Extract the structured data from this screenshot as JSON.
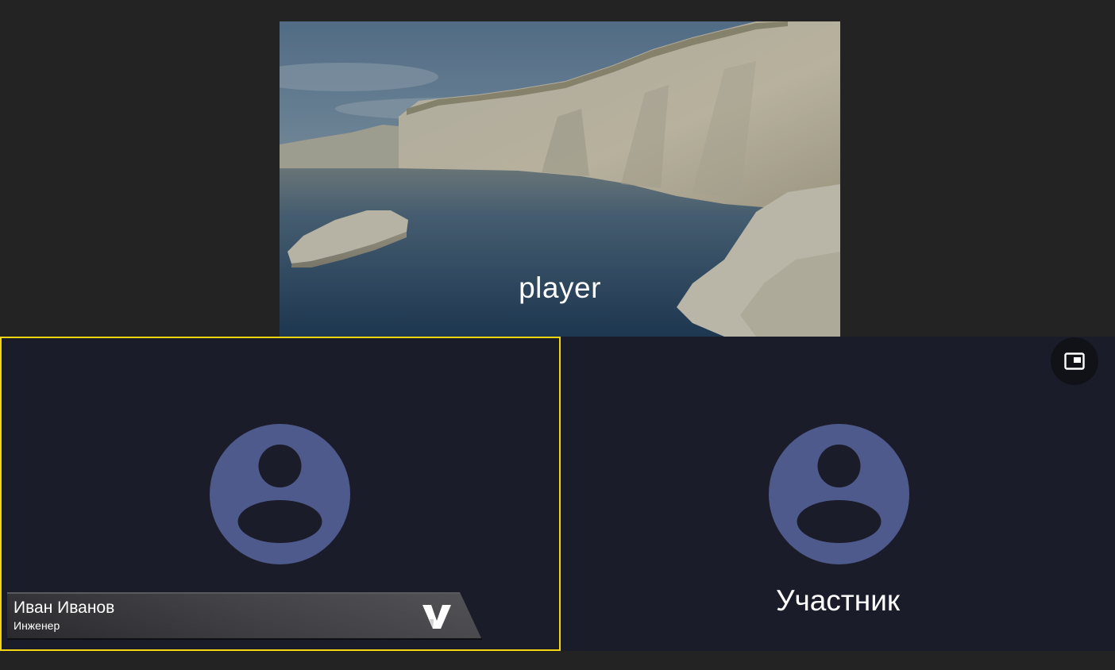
{
  "player": {
    "label": "player",
    "background": "coastal-white-cliffs-photo"
  },
  "participants": [
    {
      "id": "local",
      "avatar_icon": "user-avatar-icon",
      "active_speaker": true,
      "highlight_color": "#f4d711",
      "lower_third": {
        "name": "Иван Иванов",
        "title": "Инженер",
        "logo_icon": "v-logo-icon"
      }
    },
    {
      "id": "remote",
      "avatar_icon": "user-avatar-icon",
      "name": "Участник",
      "pip_icon": "picture-in-picture-icon"
    }
  ],
  "colors": {
    "background": "#232323",
    "tile_background": "#1b1c29",
    "avatar_fill": "#4f5a8c",
    "active_border": "#f4d711",
    "text": "#ffffff"
  }
}
